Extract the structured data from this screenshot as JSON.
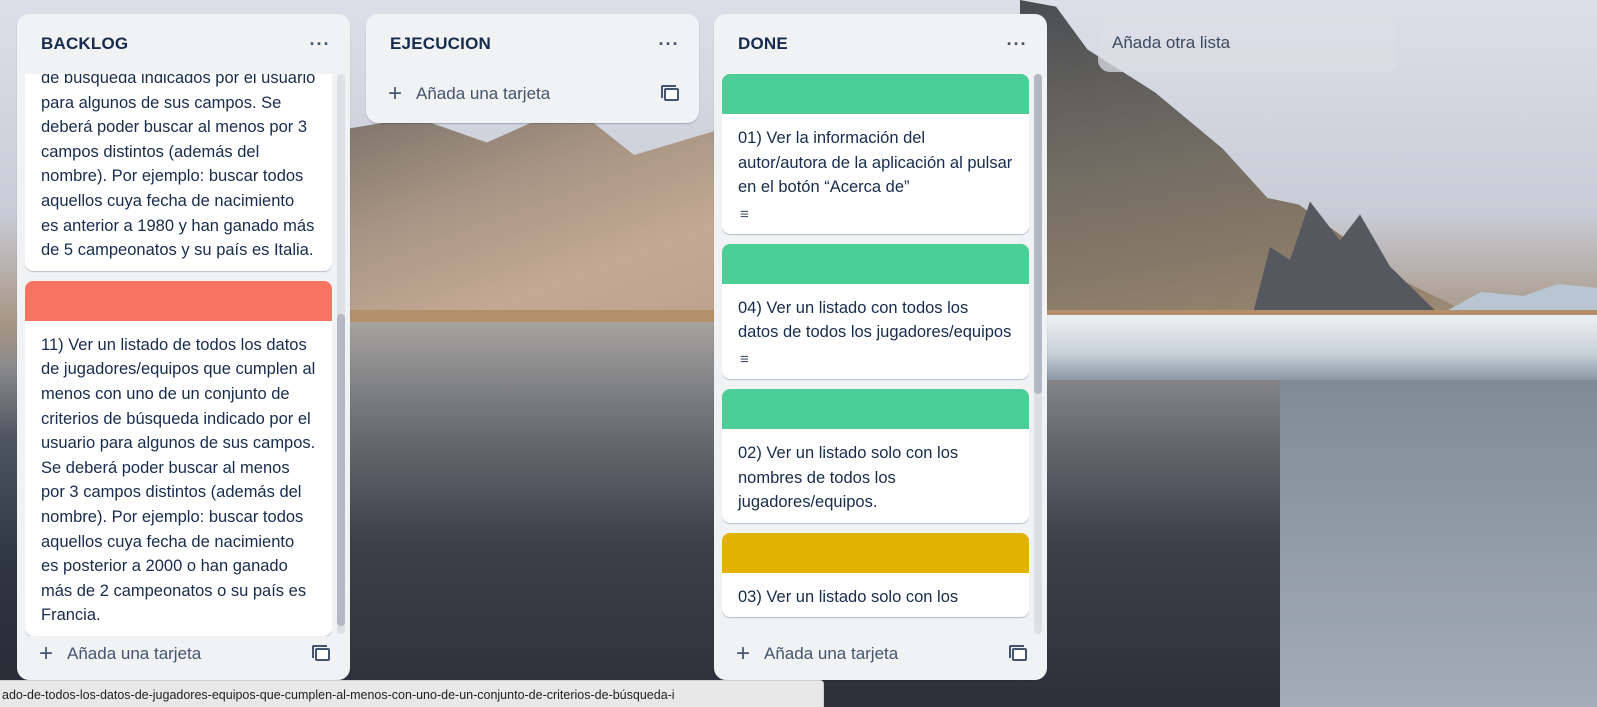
{
  "lists": [
    {
      "title": "BACKLOG",
      "cards": [
        {
          "cover_color": "",
          "text": "de búsqueda indicados por el usuario para algunos de sus campos. Se deberá poder buscar al menos por 3 campos distintos (además del nombre). Por ejemplo: buscar todos aquellos cuya fecha de nacimiento es anterior a 1980 y han ganado más de 5 campeonatos y su país es Italia."
        },
        {
          "cover_color": "#f87462",
          "text": "11) Ver un listado de todos los datos de jugadores/equipos que cumplen al menos con uno de un conjunto de criterios de búsqueda indicado por el usuario para algunos de sus campos. Se deberá poder buscar al menos por 3 campos distintos (además del nombre). Por ejemplo: buscar todos aquellos cuya fecha de nacimiento es posterior a 2000 o han ganado más de 2 campeonatos o su país es Francia."
        }
      ],
      "add_card_label": "Añada una tarjeta"
    },
    {
      "title": "EJECUCION",
      "cards": [],
      "add_card_label": "Añada una tarjeta"
    },
    {
      "title": "DONE",
      "cards": [
        {
          "cover_color": "#4bce97",
          "text": "01) Ver la información del autor/autora de la aplicación al pulsar en el botón “Acerca de”",
          "has_description": true
        },
        {
          "cover_color": "#4bce97",
          "text": "04) Ver un listado con todos los datos de todos los jugadores/equipos",
          "has_description": true
        },
        {
          "cover_color": "#4bce97",
          "text": "02) Ver un listado solo con los nombres de todos los jugadores/equipos.",
          "has_description": false
        },
        {
          "cover_color": "#e2b203",
          "text": "03) Ver un listado solo con los",
          "has_description": false
        }
      ],
      "add_card_label": "Añada una tarjeta"
    }
  ],
  "add_list_label": "Añada otra lista",
  "status_url": "ado-de-todos-los-datos-de-jugadores-equipos-que-cumplen-al-menos-con-uno-de-un-conjunto-de-criterios-de-búsqueda-i",
  "icons": {
    "menu": "more-dots-icon",
    "add": "plus-icon",
    "template": "card-template-icon",
    "description": "description-lines-icon"
  }
}
